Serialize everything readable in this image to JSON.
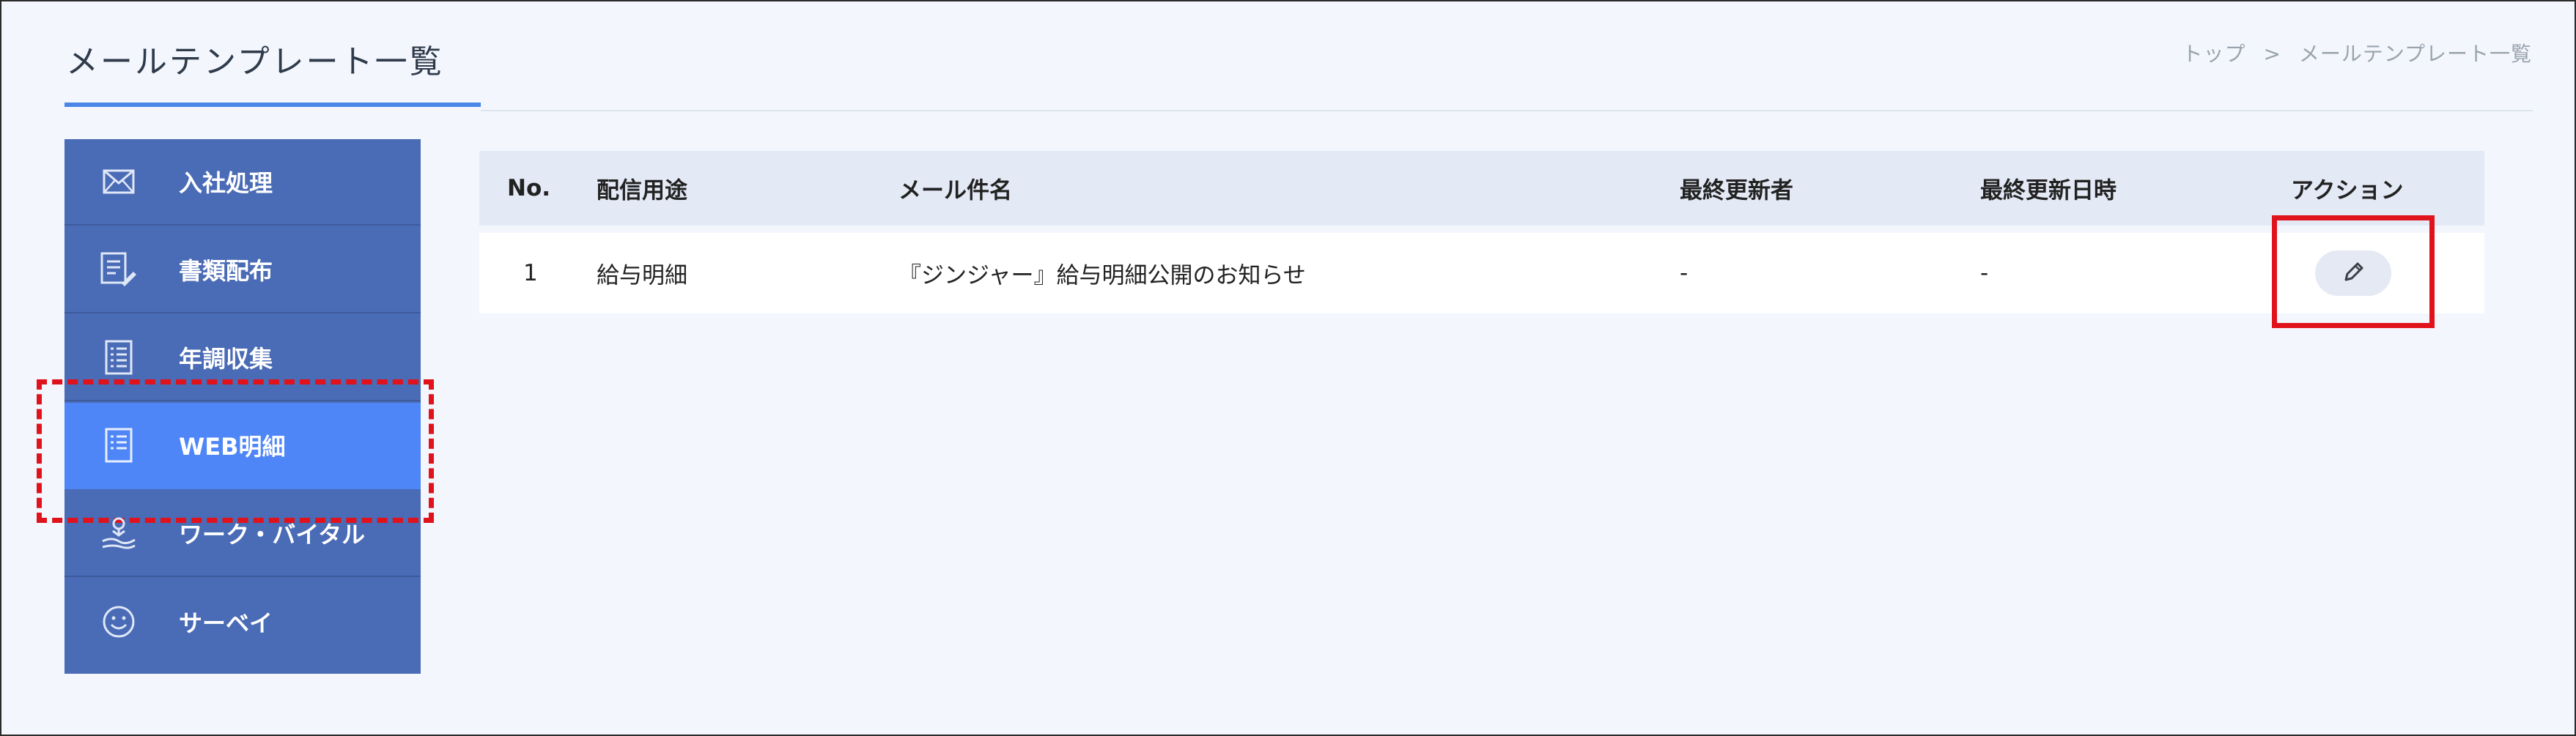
{
  "header": {
    "title": "メールテンプレート一覧",
    "breadcrumb": [
      "トップ",
      ">",
      "メールテンプレート一覧"
    ]
  },
  "sidebar": {
    "items": [
      {
        "label": "入社処理",
        "icon": "mail-icon",
        "active": false
      },
      {
        "label": "書類配布",
        "icon": "document-pen-icon",
        "active": false
      },
      {
        "label": "年調収集",
        "icon": "list-document-icon",
        "active": false
      },
      {
        "label": "WEB明細",
        "icon": "list-document-icon",
        "active": true
      },
      {
        "label": "ワーク・バイタル",
        "icon": "hand-plant-icon",
        "active": false
      },
      {
        "label": "サーベイ",
        "icon": "smiley-icon",
        "active": false
      }
    ]
  },
  "table": {
    "columns": [
      "No.",
      "配信用途",
      "メール件名",
      "最終更新者",
      "最終更新日時",
      "アクション"
    ],
    "rows": [
      {
        "no": "1",
        "usage": "給与明細",
        "subject": "『ジンジャー』給与明細公開のお知らせ",
        "updated_by": "-",
        "updated_at": "-",
        "action_icon": "pencil-icon"
      }
    ]
  },
  "colors": {
    "sidebar": "#4a6bb5",
    "sidebar_active": "#4f86f7",
    "accent": "#4a86e8",
    "annotation_red": "#e0121b",
    "page_background": "#f3f7fd"
  }
}
